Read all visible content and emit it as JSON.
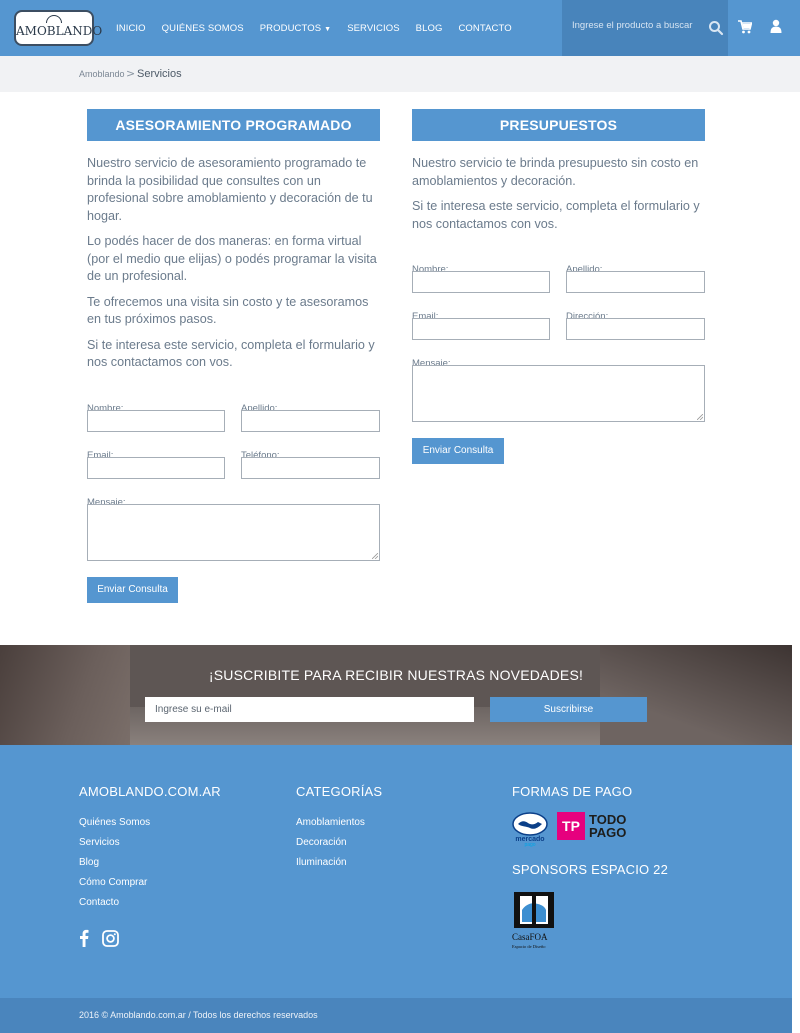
{
  "brand": {
    "logo_text": "AMOBLANDO"
  },
  "nav": {
    "items": [
      {
        "label": "INICIO"
      },
      {
        "label": "QUIÉNES SOMOS"
      },
      {
        "label": "PRODUCTOS",
        "has_caret": true
      },
      {
        "label": "SERVICIOS"
      },
      {
        "label": "BLOG"
      },
      {
        "label": "CONTACTO"
      }
    ],
    "search_placeholder": "Ingrese el producto a buscar"
  },
  "breadcrumb": {
    "home": "Amoblando",
    "separator": ">",
    "current": "Servicios"
  },
  "asesoramiento": {
    "title": "ASESORAMIENTO PROGRAMADO",
    "paragraphs": [
      "Nuestro servicio de asesoramiento programado te brinda la posibilidad que consultes con un profesional sobre amoblamiento y decoración de tu hogar.",
      "Lo podés hacer de dos maneras: en forma virtual (por el medio que elijas) o podés programar la visita de un profesional.",
      "Te ofrecemos una visita sin costo y te asesoramos en tus próximos pasos.",
      "Si te interesa este servicio, completa el formulario y nos contactamos con vos."
    ],
    "form": {
      "nombre": "Nombre:",
      "apellido": "Apellido:",
      "email": "Email:",
      "telefono": "Teléfono:",
      "mensaje": "Mensaje:",
      "submit": "Enviar Consulta"
    }
  },
  "presupuestos": {
    "title": "PRESUPUESTOS",
    "paragraphs": [
      "Nuestro servicio te brinda presupuesto sin costo en amoblamientos y decoración.",
      "Si te interesa este servicio, completa el formulario y nos contactamos con vos."
    ],
    "form": {
      "nombre": "Nombre:",
      "apellido": "Apellido:",
      "email": "Email:",
      "direccion": "Dirección:",
      "mensaje": "Mensaje:",
      "submit": "Enviar Consulta"
    }
  },
  "newsletter": {
    "title": "¡SUSCRIBITE PARA RECIBIR NUESTRAS NOVEDADES!",
    "placeholder": "Ingrese su e-mail",
    "button": "Suscribirse"
  },
  "footer": {
    "site": {
      "heading": "AMOBLANDO.COM.AR",
      "links": [
        "Quiénes Somos",
        "Servicios",
        "Blog",
        "Cómo Comprar",
        "Contacto"
      ]
    },
    "categorias": {
      "heading": "CATEGORÍAS",
      "links": [
        "Amoblamientos",
        "Decoración",
        "Iluminación"
      ]
    },
    "pagos": {
      "heading": "FORMAS DE PAGO",
      "mercadopago": {
        "line1": "mercado",
        "line2": "pago"
      },
      "todopago": {
        "badge": "TP",
        "line1": "TODO",
        "line2": "PAGO"
      }
    },
    "sponsors": {
      "heading": "SPONSORS ESPACIO 22",
      "casafoa": {
        "name": "CasaFOA",
        "tagline": "Espacio de Diseño"
      }
    },
    "social": [
      "facebook-icon",
      "instagram-icon"
    ],
    "copyright": "2016 © Amoblando.com.ar / Todos los derechos reservados"
  },
  "colors": {
    "primary": "#5596d0",
    "primary_dark": "#4884bb",
    "breadcrumb_bg": "#f1f2f4",
    "text": "#6b7b8c",
    "todopago_pink": "#e6007e"
  }
}
